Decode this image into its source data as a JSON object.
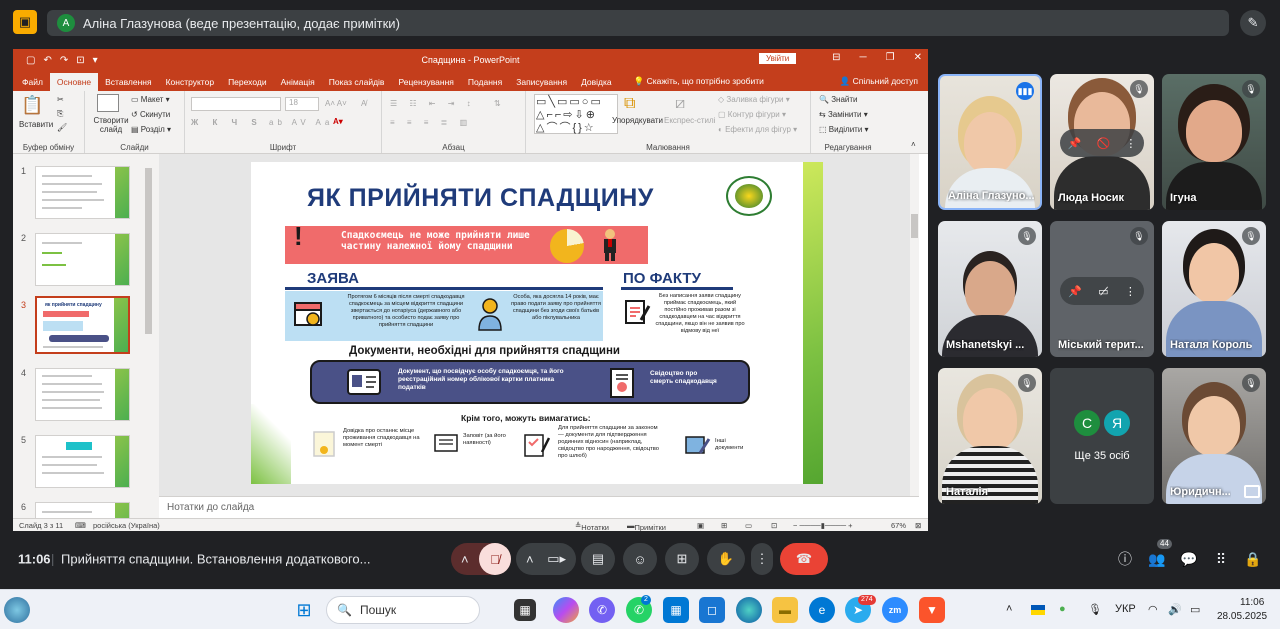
{
  "meet": {
    "presenter_initial": "А",
    "presenter_text": "Аліна Глазунова (веде презентацію, додає примітки)",
    "time": "11:06",
    "meeting_title": "Прийняття спадщини. Встановлення додаткового...",
    "participants_badge": "44"
  },
  "ppt": {
    "window_title": "Спадщина  -  PowerPoint",
    "signin": "Увійти",
    "tabs": [
      "Файл",
      "Основне",
      "Вставлення",
      "Конструктор",
      "Переходи",
      "Анімація",
      "Показ слайдів",
      "Рецензування",
      "Подання",
      "Записування",
      "Довідка"
    ],
    "tell_me": "Скажіть, що потрібно зробити",
    "share": "Спільний доступ",
    "ribbon": {
      "paste": "Вставити",
      "clipboard": "Буфер обміну",
      "new_slide": "Створити слайд",
      "layout": "Макет",
      "reset": "Скинути",
      "section": "Розділ",
      "slides": "Слайди",
      "font_group": "Шрифт",
      "font_size": "18",
      "paragraph_group": "Абзац",
      "arrange": "Упорядкувати",
      "quick_styles": "Експрес-стилі",
      "shape_fill": "Заливка фігури",
      "shape_outline": "Контур фігури",
      "shape_effects": "Ефекти для фігур",
      "drawing_group": "Малювання",
      "find": "Знайти",
      "replace": "Замінити",
      "select": "Виділити",
      "editing_group": "Редагування"
    },
    "thumb_numbers": [
      "1",
      "2",
      "3",
      "4",
      "5",
      "6"
    ],
    "thumb3_title": "як прийняти спадщину",
    "notes_placeholder": "Нотатки до слайда",
    "status": {
      "slide_of": "Слайд 3 з 11",
      "language": "російська (Україна)",
      "notes": "Нотатки",
      "comments": "Примітки",
      "zoom": "67%"
    }
  },
  "slide": {
    "title": "ЯК ПРИЙНЯТИ СПАДЩИНУ",
    "warning": "Спадкоємець не може прийняти лише частину належної йому спадщини",
    "claim_title": "ЗАЯВА",
    "fact_title": "ПО ФАКТУ",
    "claim_text_1": "Протягом 6 місяців після смерті спадкодавця спадкоємець за місцем відкриття спадщини звертається до нотаріуса (державного або приватного) та особисто подає заяву про прийняття спадщини",
    "claim_text_2": "Особа, яка досягла 14 років, має право подати заяву про прийняття спадщини без згоди своїх батьків або піклувальника",
    "fact_text": "Без написання заяви спадщину приймає спадкоємець, який постійно проживав разом зі спадкодавцем на час відкриття спадщини, якщо він не заявив про відмову від неї",
    "docs_title": "Документи, необхідні для прийняття спадщини",
    "doc_1": "Документ, що посвідчує особу спадкоємця, та його реєстраційний номер облікової картки платника податків",
    "doc_2": "Свідоцтво про смерть спадкодавця",
    "also_title": "Крім того, можуть вимагатись:",
    "also_1": "Довідка про останнє місце проживання спадкодавця на момент смерті",
    "also_2": "Заповіт (за його наявності)",
    "also_3": "Для прийняття спадщини за законом — документи для підтвердження родинних відносин (наприклад, свідоцтво про народження, свідоцтво про шлюб)",
    "also_4": "Інші документи"
  },
  "participants": [
    {
      "name": "Аліна Глазуно..."
    },
    {
      "name": "Люда Носик"
    },
    {
      "name": "Ігуна"
    },
    {
      "name": "Mshanetskyi ..."
    },
    {
      "name": "Міський терит..."
    },
    {
      "name": "Наталя Король"
    },
    {
      "name": "Наталія"
    },
    {
      "name": "Ще 35 осіб",
      "initials": [
        "С",
        "Я"
      ]
    },
    {
      "name": "Юридичн..."
    }
  ],
  "taskbar": {
    "search": "Пошук",
    "whatsapp_badge": "2",
    "telegram_badge": "274",
    "lang": "УКР",
    "clock_time": "11:06",
    "clock_date": "28.05.2025"
  },
  "colors": {
    "ppt_accent": "#c43e1c",
    "slide_navy": "#1f3b7a",
    "warning_red": "#f06b6b",
    "meet_bg": "#202124",
    "end_call": "#ea4335"
  }
}
